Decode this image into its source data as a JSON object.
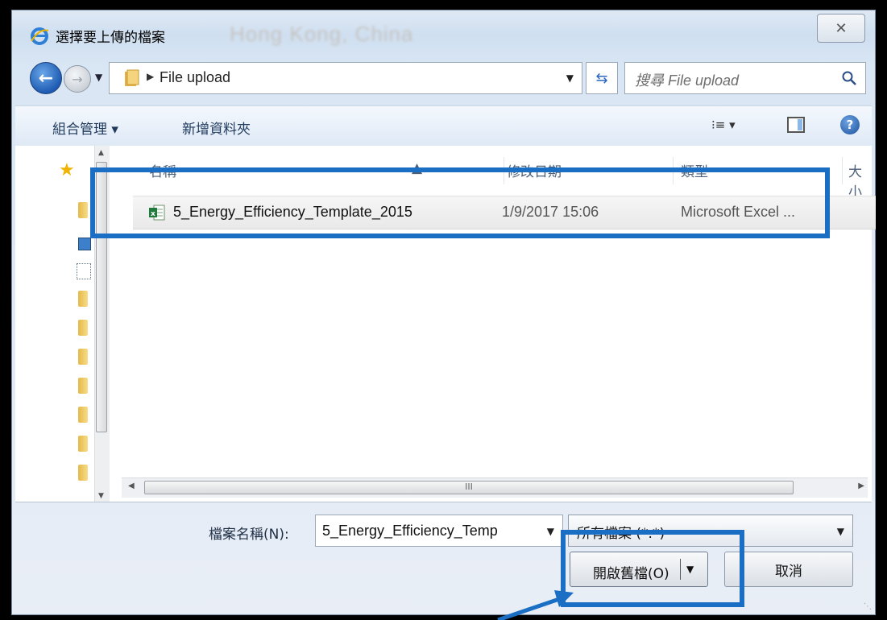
{
  "window": {
    "title": "選擇要上傳的檔案",
    "background_text": "Hong Kong, China",
    "close_glyph": "✕"
  },
  "nav": {
    "address_path": "File upload",
    "search_placeholder": "搜尋 File upload"
  },
  "toolbar": {
    "organize_label": "組合管理 ▾",
    "new_folder_label": "新增資料夾",
    "view_glyph": "⁝≡ ▾",
    "help_glyph": "?"
  },
  "columns": {
    "name": "名稱",
    "date_modified": "修改日期",
    "type": "類型",
    "size": "大小"
  },
  "files": [
    {
      "name": "5_Energy_Efficiency_Template_2015",
      "date_modified": "1/9/2017 15:06",
      "type": "Microsoft Excel ..."
    }
  ],
  "scroll": {
    "thumb_glyph": "III"
  },
  "footer": {
    "file_name_label": "檔案名稱(N):",
    "file_name_value": "5_Energy_Efficiency_Temp",
    "file_type_value": "所有檔案 (*.*)",
    "open_label": "開啟舊檔(O)",
    "cancel_label": "取消"
  },
  "colors": {
    "highlight": "#1a6fc4",
    "accent": "#1e5cb3"
  },
  "icons": [
    "ie-icon",
    "back-arrow-icon",
    "forward-arrow-icon",
    "folder-icon",
    "refresh-icon",
    "search-icon",
    "help-icon",
    "star-icon",
    "excel-icon"
  ]
}
